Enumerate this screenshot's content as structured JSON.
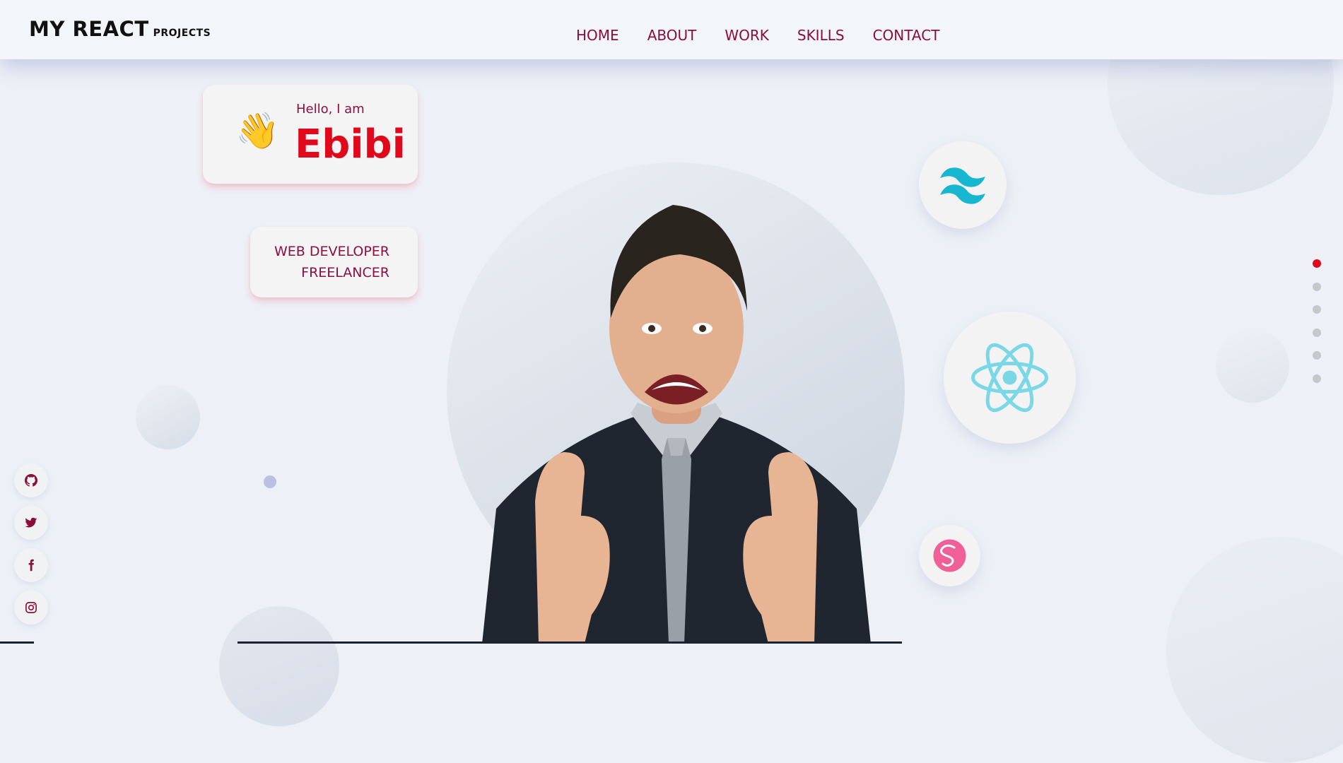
{
  "brand": {
    "title": "MY REACT",
    "subtitle": "PROJECTS"
  },
  "nav": {
    "items": [
      {
        "label": "HOME"
      },
      {
        "label": "ABOUT"
      },
      {
        "label": "WORK"
      },
      {
        "label": "SKILLS"
      },
      {
        "label": "CONTACT"
      }
    ]
  },
  "hero": {
    "greeting": "Hello, I am",
    "name": "Ebibi",
    "roles": [
      "WEB DEVELOPER",
      "FREELANCER"
    ]
  },
  "tech_icons": [
    "tailwind-icon",
    "react-icon",
    "sass-icon"
  ],
  "section_dots": {
    "count": 6,
    "active_index": 0
  },
  "social_icons": [
    "github-icon",
    "twitter-icon",
    "facebook-icon",
    "instagram-icon"
  ],
  "colors": {
    "accent": "#e0091c",
    "nav_text": "#8b0e3a",
    "background": "#edf1f7"
  }
}
